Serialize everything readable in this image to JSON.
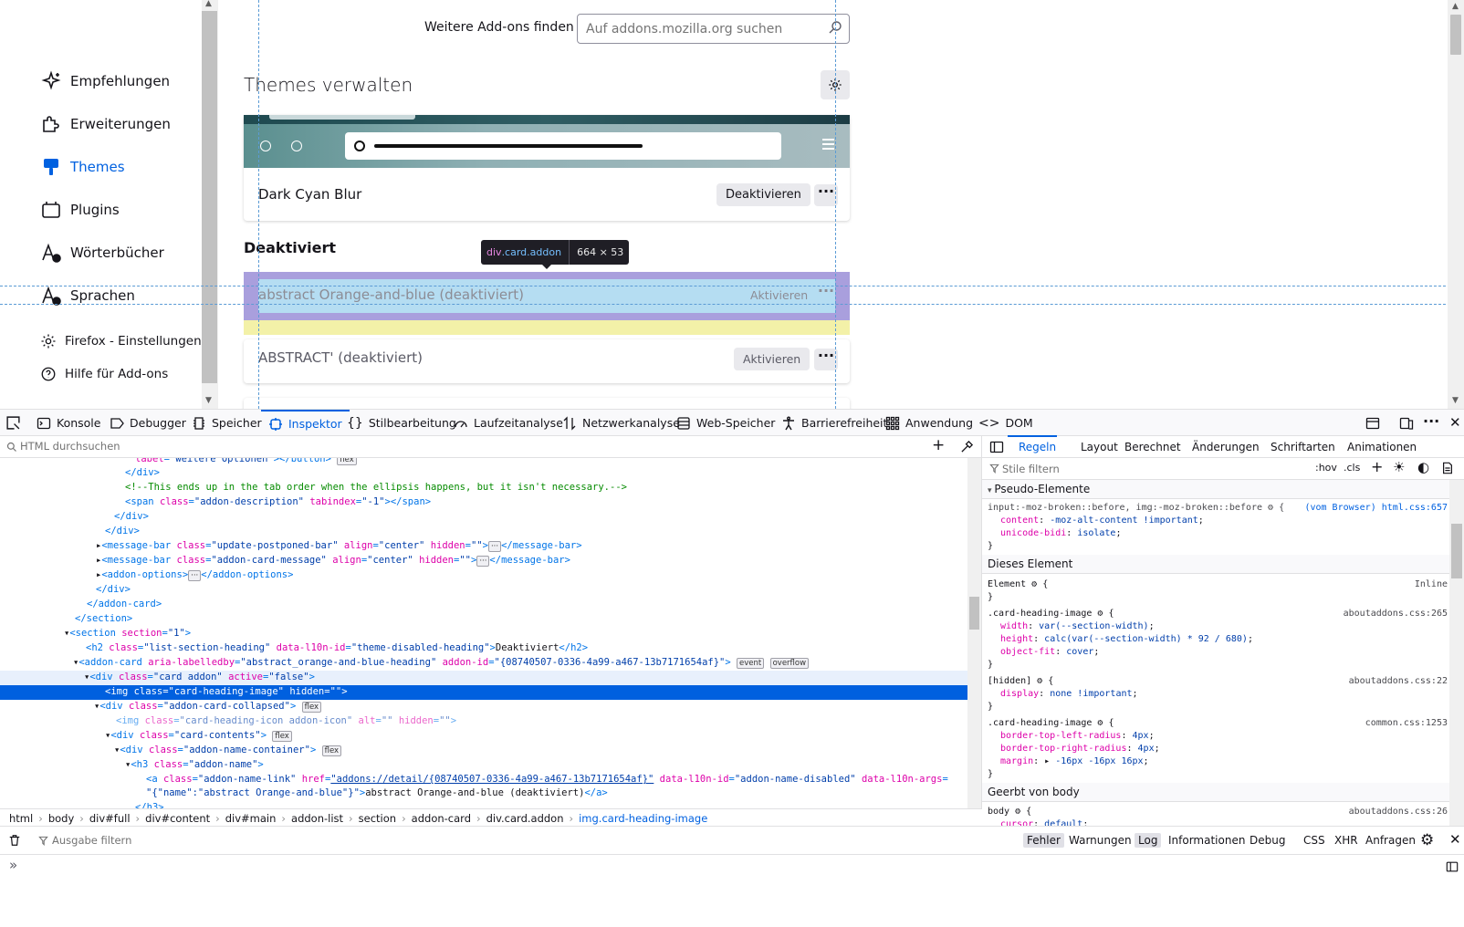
{
  "sidebar": {
    "items": [
      {
        "label": "Empfehlungen",
        "icon": "sparkle-icon"
      },
      {
        "label": "Erweiterungen",
        "icon": "puzzle-icon"
      },
      {
        "label": "Themes",
        "icon": "brush-icon"
      },
      {
        "label": "Plugins",
        "icon": "plugin-icon"
      },
      {
        "label": "Wörterbücher",
        "icon": "dictionary-icon"
      },
      {
        "label": "Sprachen",
        "icon": "language-icon"
      }
    ],
    "footer": [
      {
        "label": "Firefox - Einstellungen",
        "icon": "gear-icon"
      },
      {
        "label": "Hilfe für Add-ons",
        "icon": "help-icon"
      }
    ]
  },
  "header": {
    "find_label": "Weitere Add-ons finden",
    "search_placeholder": "Auf addons.mozilla.org suchen",
    "title": "Themes verwalten"
  },
  "enabled_theme": {
    "name": "Dark Cyan Blur",
    "button": "Deaktivieren",
    "more": "···"
  },
  "disabled": {
    "heading": "Deaktiviert",
    "items": [
      {
        "name": "abstract Orange-and-blue (deaktiviert)",
        "button": "Aktivieren",
        "more": "···"
      },
      {
        "name": "ABSTRACT' (deaktiviert)",
        "button": "Aktivieren",
        "more": "···"
      }
    ]
  },
  "highlighter": {
    "tag": "div",
    "classes": ".card.addon",
    "dims": "664 × 53"
  },
  "devtools": {
    "tabs": [
      "Konsole",
      "Debugger",
      "Speicher",
      "Inspektor",
      "Stilbearbeitung",
      "Laufzeitanalyse",
      "Netzwerkanalyse",
      "Web-Speicher",
      "Barrierefreiheit",
      "Anwendung",
      "DOM"
    ],
    "html_search_placeholder": "HTML durchsuchen",
    "breadcrumbs": [
      "html",
      "body",
      "div#full",
      "div#content",
      "div#main",
      "addon-list",
      "section",
      "addon-card",
      "div.card.addon",
      "img.card-heading-image"
    ],
    "rules_tabs": [
      "Regeln",
      "Layout",
      "Berechnet",
      "Änderungen",
      "Schriftarten",
      "Animationen"
    ],
    "rules_filter_placeholder": "Stile filtern",
    "rules_toggles": [
      ":hov",
      ".cls"
    ],
    "sections": {
      "pseudo": "Pseudo-Elemente",
      "this": "Dieses Element",
      "inherited": "Geerbt von body"
    },
    "console": {
      "filter_placeholder": "Ausgabe filtern",
      "filters": [
        "Fehler",
        "Warnungen",
        "Log",
        "Informationen",
        "Debug",
        "CSS",
        "XHR",
        "Anfragen"
      ],
      "prompt": "»"
    }
  }
}
